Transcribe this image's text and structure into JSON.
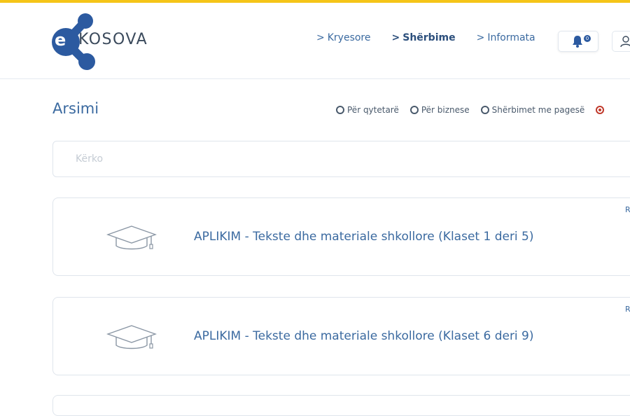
{
  "logo": {
    "letter": "e",
    "text": "KOSOVA"
  },
  "nav": {
    "items": [
      {
        "label": "Kryesore",
        "active": false
      },
      {
        "label": "Shërbime",
        "active": true
      },
      {
        "label": "Informata",
        "active": false
      }
    ],
    "notifications_count": "0"
  },
  "page": {
    "title": "Arsimi"
  },
  "filters": [
    {
      "label": "Për qytetarë"
    },
    {
      "label": "Për biznese"
    },
    {
      "label": "Shërbimet me pagesë"
    }
  ],
  "search": {
    "placeholder": "Kërko"
  },
  "services": [
    {
      "title": "APLIKIM - Tekste dhe materiale shkollore (Klaset 1 deri 5)",
      "corner": "R"
    },
    {
      "title": "APLIKIM - Tekste dhe materiale shkollore (Klaset 6 deri 9)",
      "corner": "R"
    }
  ],
  "colors": {
    "accent_bar": "#f5c518",
    "brand_blue": "#2c5aa0",
    "link_blue": "#3b6aa0"
  },
  "icons": [
    "bell-icon",
    "user-icon",
    "graduation-cap-icon",
    "chevron-right-icon"
  ]
}
